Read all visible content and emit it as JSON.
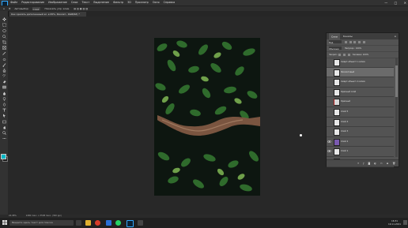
{
  "app": {
    "menu": [
      "Файл",
      "Редактирование",
      "Изображение",
      "Слои",
      "Текст",
      "Выделение",
      "Фильтр",
      "3D",
      "Просмотр",
      "Окно",
      "Справка"
    ],
    "window_controls": [
      "—",
      "□",
      "✕"
    ],
    "options": [
      "Автовыбор:",
      "Слой",
      "Показать упр. элем."
    ]
  },
  "document_tab": "Как сделать дополненный эл. в 65%, Фиолет., RGB/8#) *",
  "status": {
    "zoom": "24.98%",
    "doc_size": "2480 пикс. x 3508 пикс. (300 ppi)"
  },
  "layers_panel": {
    "tabs": [
      "Слои",
      "Каналы"
    ],
    "filter": "Вид",
    "blend": "Обычные",
    "opacity_label": "Непрозр.:",
    "opacity": "100%",
    "lock_label": "Закреп.:",
    "fill_label": "Заливка:",
    "fill": "100%",
    "layers": [
      {
        "name": "Смарт-объект 1 копия",
        "thumb": "white",
        "visible": false,
        "selected": false
      },
      {
        "name": "Фиолетовый",
        "thumb": "white",
        "visible": false,
        "selected": true
      },
      {
        "name": "Смарт-объект 2 копия",
        "thumb": "white",
        "visible": false,
        "selected": false
      },
      {
        "name": "Красный слой",
        "thumb": "white",
        "visible": false,
        "selected": false
      },
      {
        "name": "Красный",
        "thumb": "red",
        "visible": false,
        "selected": false
      },
      {
        "name": "Слой 5",
        "thumb": "white",
        "visible": false,
        "selected": false
      },
      {
        "name": "Слой 4",
        "thumb": "white",
        "visible": false,
        "selected": false
      },
      {
        "name": "Слой 3",
        "thumb": "white",
        "visible": false,
        "selected": false
      },
      {
        "name": "Слой 2",
        "thumb": "purple",
        "visible": true,
        "selected": false
      },
      {
        "name": "Слой 1",
        "thumb": "white",
        "visible": true,
        "selected": false
      },
      {
        "name": "Фон",
        "thumb": "photo",
        "visible": true,
        "selected": false
      }
    ]
  },
  "taskbar": {
    "search_placeholder": "Введите здесь текст для поиска",
    "time": "16:31",
    "date": "19.11.2021"
  },
  "colors": {
    "foreground": "#00b7c6",
    "background": "#1e1e1e",
    "ps_accent": "#31a8ff"
  }
}
